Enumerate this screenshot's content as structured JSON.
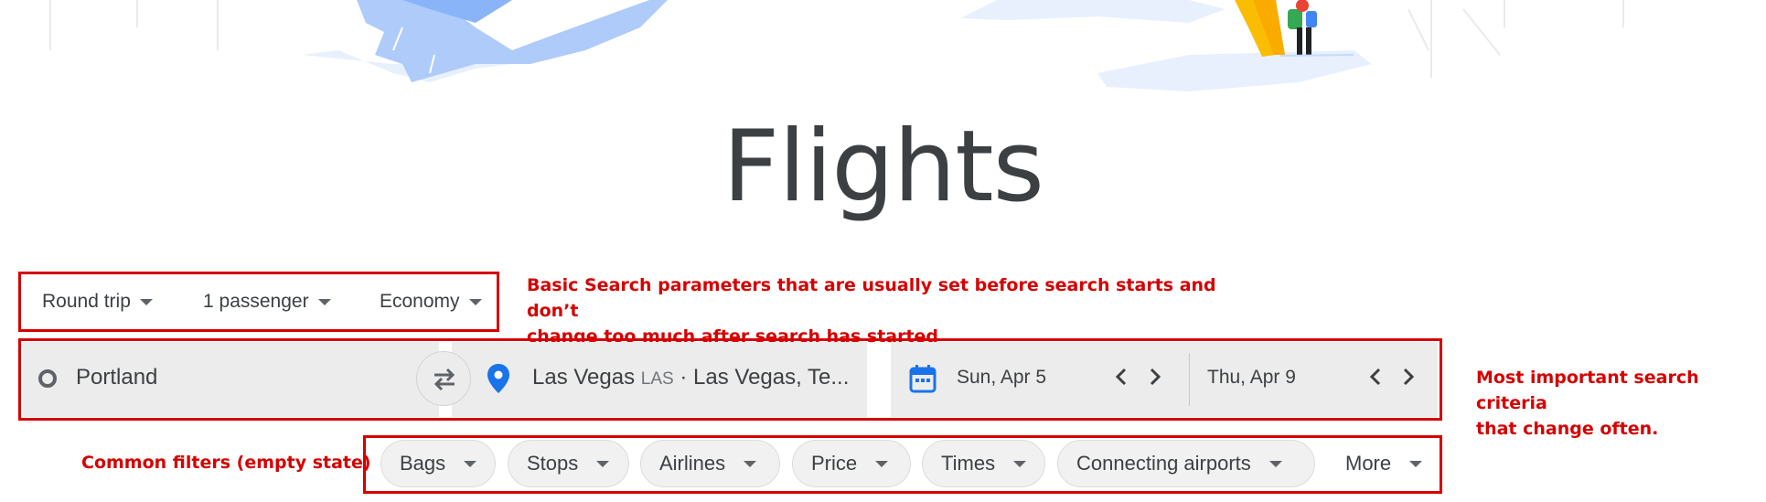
{
  "page": {
    "title": "Flights"
  },
  "trip_options": {
    "trip_type": "Round trip",
    "passengers": "1 passenger",
    "cabin_class": "Economy"
  },
  "search": {
    "origin": "Portland",
    "destination_city": "Las Vegas",
    "destination_code": "LAS",
    "destination_region": "· Las Vegas, Te...",
    "depart_date": "Sun, Apr 5",
    "return_date": "Thu, Apr 9"
  },
  "filters": {
    "chips": [
      "Bags",
      "Stops",
      "Airlines",
      "Price",
      "Times",
      "Connecting airports",
      "More"
    ]
  },
  "annotations": {
    "basic_params_line1": "Basic Search parameters that are usually set before search starts and don’t",
    "basic_params_line2": "change too much after search has started",
    "search_criteria_line1": "Most important search criteria",
    "search_criteria_line2": "that change often.",
    "filters_label": "Common filters (empty state)"
  },
  "colors": {
    "annotation_red": "#d50000",
    "field_bg": "#ececec",
    "accent_blue": "#1a73e8",
    "hero_blue": "#aecbfa"
  },
  "icons": [
    "circle-origin-icon",
    "swap-icon",
    "location-pin-icon",
    "calendar-icon",
    "chevron-left-icon",
    "chevron-right-icon",
    "dropdown-caret-icon"
  ]
}
